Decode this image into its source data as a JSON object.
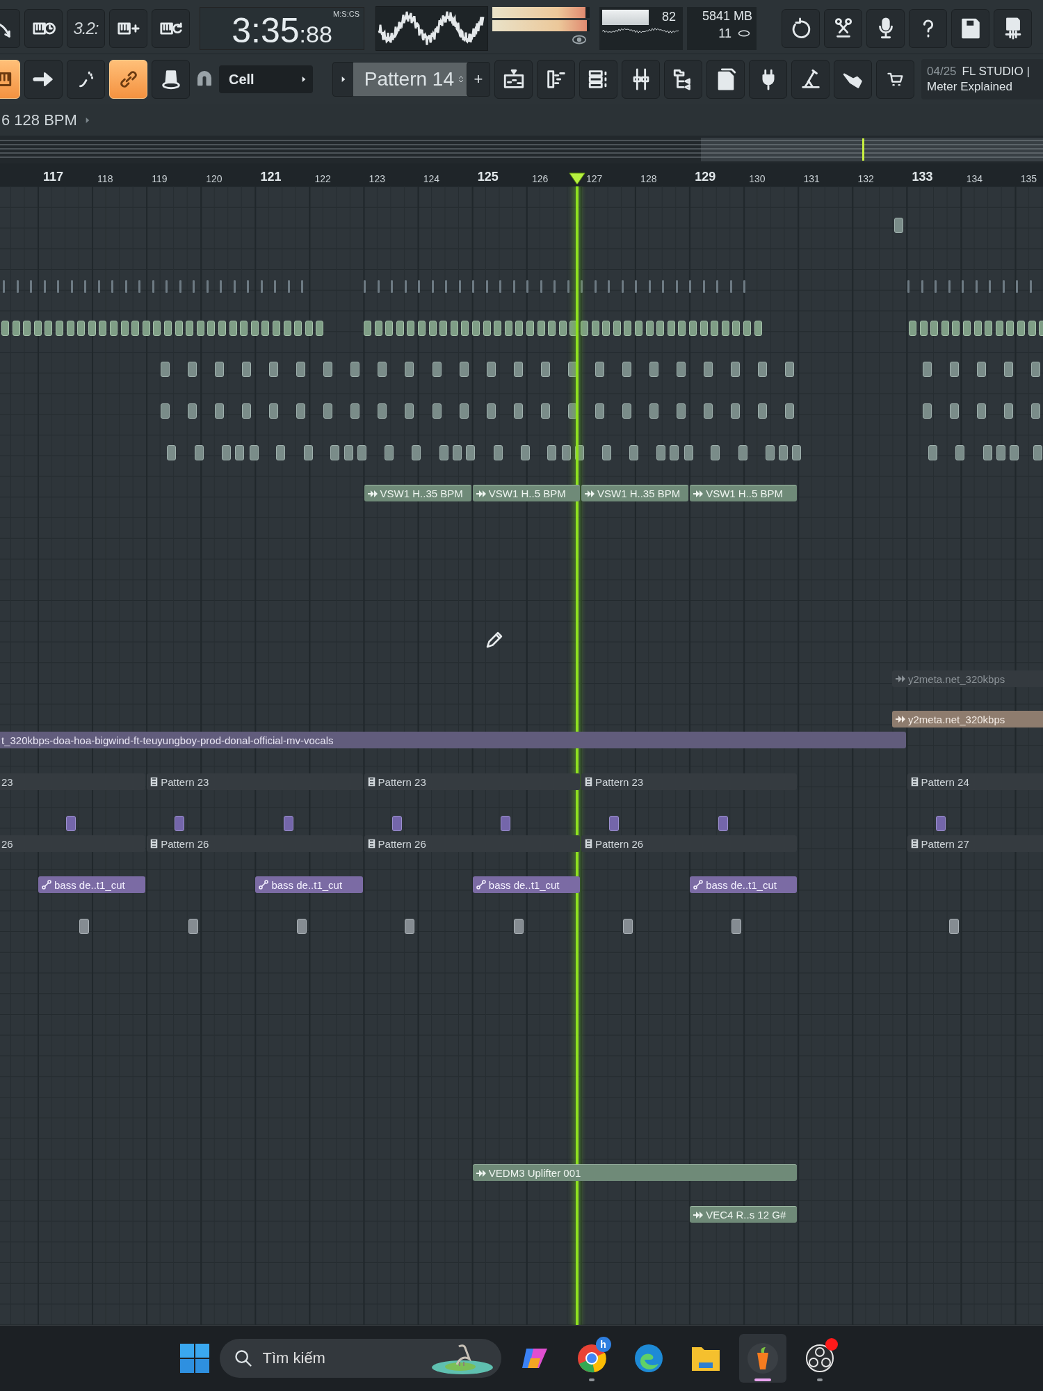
{
  "toolbar_1": {
    "count_button": "3.2:",
    "time": {
      "main": "3:35",
      "sub": ":88",
      "format": "M:S:CS"
    },
    "meters": [
      {
        "level": 0.96
      },
      {
        "level": 0.97
      }
    ],
    "cpu": {
      "level": 0.82,
      "value": "82"
    },
    "memory": "5841 MB",
    "polyphony": "11"
  },
  "toolbar_2": {
    "toggles": [
      {
        "on": true
      },
      {
        "on": false
      },
      {
        "on": false
      },
      {
        "on": true
      },
      {
        "on": false
      }
    ],
    "snap": "Cell",
    "pattern": "Pattern 14",
    "add": "+",
    "hint": {
      "counter": "04/25",
      "title": "FL STUDIO |",
      "text": "Meter Explained"
    }
  },
  "tempo_bar": "6 128 BPM",
  "ruler": [
    "117",
    "118",
    "119",
    "120",
    "121",
    "122",
    "123",
    "124",
    "125",
    "126",
    "127",
    "128",
    "129",
    "130",
    "131",
    "132",
    "133",
    "134",
    "135"
  ],
  "tracks": [
    {
      "kind": "step-blips"
    },
    {
      "kind": "tick-blips"
    },
    {
      "kind": "green-blips"
    },
    {
      "kind": "step-blips"
    },
    {
      "kind": "step-blips"
    },
    {
      "kind": "step-blips"
    },
    {
      "kind": "clips",
      "clips": [
        {
          "kind": "audio",
          "label": "VSW1 H..35 BPM"
        },
        {
          "kind": "audio",
          "label": "VSW1 H..5 BPM"
        },
        {
          "kind": "audio",
          "label": "VSW1 H..35 BPM"
        },
        {
          "kind": "audio",
          "label": "VSW1 H..5 BPM"
        }
      ]
    },
    {
      "kind": "clips",
      "clips": [
        {
          "kind": "audio-muted",
          "label": "y2meta.net_320kbps"
        }
      ]
    },
    {
      "kind": "clips",
      "clips": [
        {
          "kind": "audio-tan",
          "label": "y2meta.net_320kbps"
        }
      ]
    },
    {
      "kind": "clips",
      "clips": [
        {
          "kind": "vocals",
          "label": "t_320kbps-doa-hoa-bigwind-ft-teuyungboy-prod-donal-official-mv-vocals"
        }
      ]
    },
    {
      "kind": "clips",
      "clips": [
        {
          "kind": "pattern",
          "label": "23"
        },
        {
          "kind": "pattern",
          "label": "Pattern 23"
        },
        {
          "kind": "pattern",
          "label": "Pattern 23"
        },
        {
          "kind": "pattern",
          "label": "Pattern 23"
        },
        {
          "kind": "pattern",
          "label": "Pattern 24"
        }
      ]
    },
    {
      "kind": "purple-blips"
    },
    {
      "kind": "clips",
      "clips": [
        {
          "kind": "pattern",
          "label": "26"
        },
        {
          "kind": "pattern",
          "label": "Pattern 26"
        },
        {
          "kind": "pattern",
          "label": "Pattern 26"
        },
        {
          "kind": "pattern",
          "label": "Pattern 26"
        },
        {
          "kind": "pattern",
          "label": "Pattern 27"
        }
      ]
    },
    {
      "kind": "clips",
      "clips": [
        {
          "kind": "automation",
          "label": "bass de..t1_cut"
        },
        {
          "kind": "automation",
          "label": "bass de..t1_cut"
        },
        {
          "kind": "automation",
          "label": "bass de..t1_cut"
        },
        {
          "kind": "automation",
          "label": "bass de..t1_cut"
        }
      ]
    },
    {
      "kind": "gray-blips"
    },
    {
      "kind": "clips",
      "clips": [
        {
          "kind": "audio",
          "label": "VEDM3 Uplifter 001"
        }
      ]
    },
    {
      "kind": "clips",
      "clips": [
        {
          "kind": "audio",
          "label": "VEC4 R..s 12 G#"
        }
      ]
    }
  ],
  "taskbar": {
    "search": {
      "placeholder": "Tìm kiếm"
    },
    "apps": [
      {
        "running": false,
        "selected": false
      },
      {
        "running": true,
        "selected": false,
        "badge": "h"
      },
      {
        "running": false,
        "selected": false
      },
      {
        "running": false,
        "selected": false
      },
      {
        "running": true,
        "selected": true
      },
      {
        "running": true,
        "selected": false,
        "notification": true
      }
    ]
  }
}
